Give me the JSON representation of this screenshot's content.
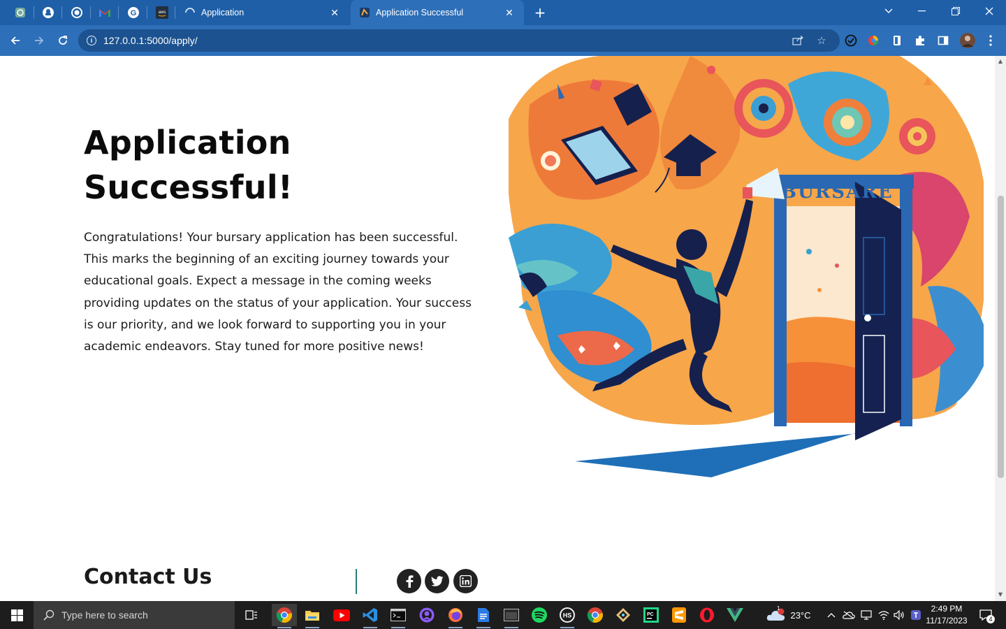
{
  "browser": {
    "tabs": [
      {
        "title": "Application",
        "active": false
      },
      {
        "title": "Application Successful",
        "active": true
      }
    ],
    "new_tab": "+",
    "url": "127.0.0.1:5000/apply/",
    "pinned_icons": [
      "chatgpt-icon",
      "github-icon",
      "whatsapp-icon",
      "gmail-icon",
      "grammarly-icon",
      "aws-icon"
    ],
    "accent": "#1f5fa8"
  },
  "page": {
    "headline_line1": "Application",
    "headline_line2": "Successful!",
    "body": "Congratulations! Your bursary application has been successful. This marks the beginning of an exciting journey towards your educational goals. Expect a message in the coming weeks providing updates on the status of your application. Your success is our priority, and we look forward to supporting you in your academic endeavors. Stay tuned for more positive news!",
    "hero_sign": "BURSARE",
    "contact_title": "Contact Us",
    "social": [
      {
        "name": "facebook",
        "glyph": "f"
      },
      {
        "name": "twitter",
        "glyph": "t"
      },
      {
        "name": "linkedin",
        "glyph": "in"
      }
    ]
  },
  "taskbar": {
    "search_placeholder": "Type here to search",
    "weather": "23°C",
    "time": "2:49 PM",
    "date": "11/17/2023",
    "notification_count": "4",
    "weather_badge": "1"
  }
}
